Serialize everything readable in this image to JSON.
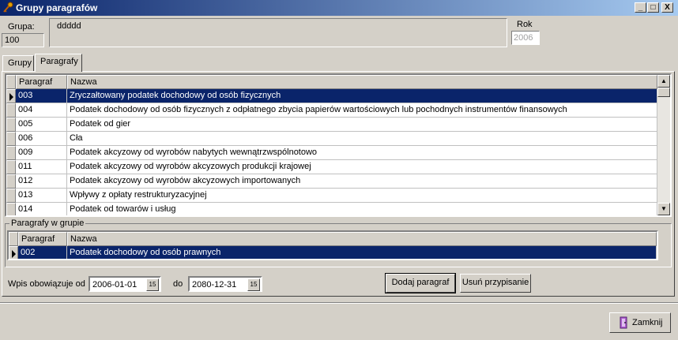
{
  "window": {
    "title": "Grupy paragrafów",
    "minimize": "_",
    "maximize": "□",
    "close": "X"
  },
  "header": {
    "grupa_label": "Grupa:",
    "grupa_value": "100",
    "nazwa_value": "ddddd",
    "rok_label": "Rok",
    "rok_value": "2006"
  },
  "tabs": [
    {
      "label": "Grupy",
      "active": false
    },
    {
      "label": "Paragrafy",
      "active": true
    }
  ],
  "paragraphs_grid": {
    "columns": [
      "Paragraf",
      "Nazwa"
    ],
    "rows": [
      {
        "code": "003",
        "name": "Zryczałtowany podatek dochodowy od osób fizycznych",
        "selected": true
      },
      {
        "code": "004",
        "name": "Podatek dochodowy od osób fizycznych z odpłatnego zbycia papierów wartościowych lub pochodnych instrumentów finansowych",
        "selected": false
      },
      {
        "code": "005",
        "name": "Podatek od gier",
        "selected": false
      },
      {
        "code": "006",
        "name": "Cła",
        "selected": false
      },
      {
        "code": "009",
        "name": "Podatek akcyzowy od wyrobów nabytych wewnątrzwspólnotowo",
        "selected": false
      },
      {
        "code": "011",
        "name": "Podatek akcyzowy od wyrobów akcyzowych produkcji krajowej",
        "selected": false
      },
      {
        "code": "012",
        "name": "Podatek akcyzowy od wyrobów akcyzowych importowanych",
        "selected": false
      },
      {
        "code": "013",
        "name": "Wpływy z opłaty restrukturyzacyjnej",
        "selected": false
      },
      {
        "code": "014",
        "name": "Podatek od towarów i usług",
        "selected": false
      }
    ]
  },
  "group_section": {
    "title": "Paragrafy w grupie",
    "columns": [
      "Paragraf",
      "Nazwa"
    ],
    "rows": [
      {
        "code": "002",
        "name": "Podatek dochodowy od osób prawnych",
        "selected": true
      }
    ]
  },
  "validity": {
    "from_label": "Wpis obowiązuje od",
    "from_value": "2006-01-01",
    "to_label": "do",
    "to_value": "2080-12-31",
    "calendar_glyph": "15"
  },
  "actions": {
    "add_label": "Dodaj paragraf",
    "remove_label": "Usuń przypisanie",
    "close_label": "Zamknij"
  },
  "icons": {
    "app": "key-icon",
    "close_button": "door-exit-icon"
  },
  "colors": {
    "titlebar_start": "#0a246a",
    "titlebar_end": "#a6caf0",
    "selection": "#0a246a",
    "face": "#d4d0c8"
  }
}
